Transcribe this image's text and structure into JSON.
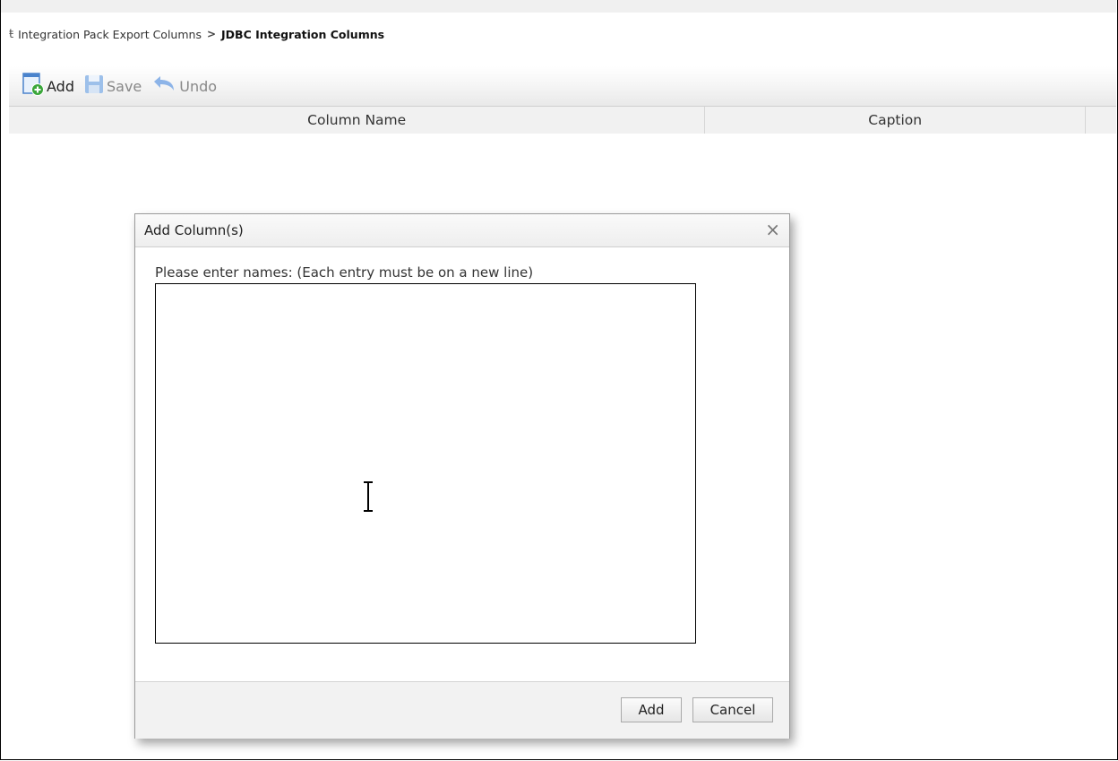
{
  "breadcrumb": {
    "icon": "export-icon",
    "parent": "Integration Pack Export Columns",
    "separator": ">",
    "current": "JDBC Integration Columns"
  },
  "toolbar": {
    "add_label": "Add",
    "save_label": "Save",
    "undo_label": "Undo"
  },
  "grid": {
    "columns": [
      "Column Name",
      "Caption"
    ]
  },
  "dialog": {
    "title": "Add Column(s)",
    "close_glyph": "×",
    "instruction": "Please enter names: (Each entry must be on a new line)",
    "textarea_value": "",
    "add_button": "Add",
    "cancel_button": "Cancel"
  },
  "colors": {
    "accent_blue": "#3a7bd5",
    "add_green": "#3aa63a",
    "disabled_icon": "#8db4e8"
  }
}
